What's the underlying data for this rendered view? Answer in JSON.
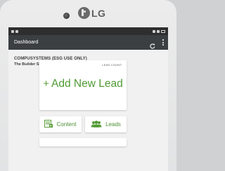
{
  "device": {
    "brand": "LG",
    "brand_icon": "lg-logo-icon"
  },
  "statusbar": {
    "left_icons": [
      "usb-icon",
      "signal-icon"
    ],
    "right_icons": [
      "bluetooth-icon",
      "wifi-icon",
      "battery-icon"
    ]
  },
  "appbar": {
    "title": "Dashboard",
    "refresh_icon": "refresh-icon",
    "menu_icon": "overflow-menu-icon",
    "background": "#3b3f42"
  },
  "org": {
    "company": "COMPUSYSTEMS (ESG USE ONLY)",
    "show": "The Builder Show"
  },
  "lead_card": {
    "count_label": "LEAD COUNT:",
    "count_value": "",
    "plus": "+",
    "label": "Add New Lead"
  },
  "tiles": [
    {
      "label": "Content",
      "icon": "content-icon"
    },
    {
      "label": "Leads",
      "icon": "people-icon"
    }
  ],
  "colors": {
    "accent_green": "#4f9a33",
    "screen_bg": "#f1f1f1"
  }
}
